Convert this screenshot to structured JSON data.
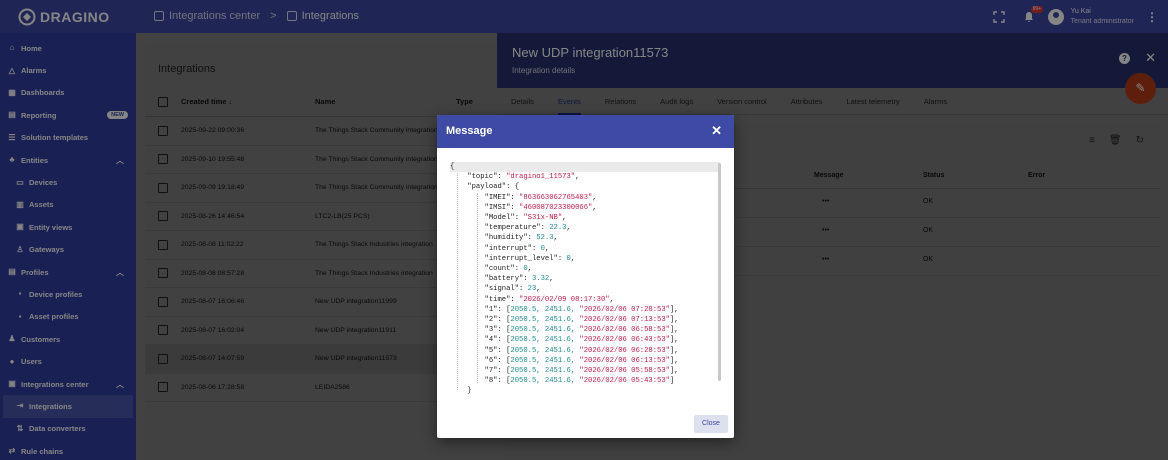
{
  "app": {
    "logo_text": "DRAGINO"
  },
  "breadcrumb": {
    "parent": "Integrations center",
    "current": "Integrations",
    "separator": ">"
  },
  "topbar": {
    "notification_count": "99+",
    "user_name": "Yu Kai",
    "user_role": "Tenant administrator"
  },
  "sidebar": {
    "items": [
      {
        "label": "Home",
        "icon": "home-icon"
      },
      {
        "label": "Alarms",
        "icon": "alarm-icon"
      },
      {
        "label": "Dashboards",
        "icon": "dashboard-icon"
      },
      {
        "label": "Reporting",
        "icon": "reporting-icon",
        "badge": "NEW"
      },
      {
        "label": "Solution templates",
        "icon": "template-icon"
      },
      {
        "label": "Entities",
        "icon": "entities-icon"
      },
      {
        "label": "Devices",
        "icon": "devices-icon"
      },
      {
        "label": "Assets",
        "icon": "assets-icon"
      },
      {
        "label": "Entity views",
        "icon": "entity-views-icon"
      },
      {
        "label": "Gateways",
        "icon": "gateways-icon"
      },
      {
        "label": "Profiles",
        "icon": "profiles-icon"
      },
      {
        "label": "Device profiles",
        "icon": "device-profiles-icon"
      },
      {
        "label": "Asset profiles",
        "icon": "asset-profiles-icon"
      },
      {
        "label": "Customers",
        "icon": "customers-icon"
      },
      {
        "label": "Users",
        "icon": "users-icon"
      },
      {
        "label": "Integrations center",
        "icon": "integrations-center-icon"
      },
      {
        "label": "Integrations",
        "icon": "integrations-icon"
      },
      {
        "label": "Data converters",
        "icon": "data-converters-icon"
      },
      {
        "label": "Rule chains",
        "icon": "rule-chains-icon"
      }
    ]
  },
  "integrations": {
    "title": "Integrations",
    "columns": {
      "created": "Created time",
      "name": "Name",
      "type": "Type"
    },
    "rows": [
      {
        "created": "2025-09-22 09:00:36",
        "name": "The Things Stack Community integration"
      },
      {
        "created": "2025-09-10 19:55:48",
        "name": "The Things Stack Community integration"
      },
      {
        "created": "2025-09-09 19:18:49",
        "name": "The Things Stack Community integration"
      },
      {
        "created": "2025-08-26 14:46:54",
        "name": "LTC2-LB(25 PCS)"
      },
      {
        "created": "2025-08-08 11:02:22",
        "name": "The Things Stack Industries integration"
      },
      {
        "created": "2025-08-08 08:57:28",
        "name": "The Things Stack Industries integration"
      },
      {
        "created": "2025-08-07 16:06:46",
        "name": "New UDP integration11999"
      },
      {
        "created": "2025-08-07 16:02:04",
        "name": "New UDP integration11911"
      },
      {
        "created": "2025-08-07 14:07:59",
        "name": "New UDP integration11573"
      },
      {
        "created": "2025-08-06 17:28:58",
        "name": "LEIDA2586"
      }
    ]
  },
  "details": {
    "title": "New UDP integration11573",
    "subtitle": "Integration details",
    "tabs": [
      "Details",
      "Events",
      "Relations",
      "Audit logs",
      "Version control",
      "Attributes",
      "Latest telemetry",
      "Alarms"
    ],
    "events": {
      "columns": {
        "message": "Message",
        "status": "Status",
        "error": "Error"
      },
      "rows": [
        {
          "message": "•••",
          "status": "OK"
        },
        {
          "message": "•••",
          "status": "OK"
        },
        {
          "message": "•••",
          "status": "OK"
        }
      ]
    }
  },
  "dialog": {
    "title": "Message",
    "close_label": "Close",
    "json_lines": [
      {
        "text": "{",
        "cls": "k"
      },
      {
        "text": "    \"topic\": ",
        "val": "\"dragino1_11573\"",
        "vcls": "s",
        "tail": ","
      },
      {
        "text": "    \"payload\": {",
        "cls": "k"
      },
      {
        "text": "        \"IMEI\": ",
        "val": "\"863663062765403\"",
        "vcls": "s",
        "tail": ","
      },
      {
        "text": "        \"IMSI\": ",
        "val": "\"460087023300066\"",
        "vcls": "s",
        "tail": ","
      },
      {
        "text": "        \"Model\": ",
        "val": "\"S31x-NB\"",
        "vcls": "s",
        "tail": ","
      },
      {
        "text": "        \"temperature\": ",
        "val": "22.3",
        "vcls": "n",
        "tail": ","
      },
      {
        "text": "        \"humidity\": ",
        "val": "52.3",
        "vcls": "n",
        "tail": ","
      },
      {
        "text": "        \"interrupt\": ",
        "val": "0",
        "vcls": "n",
        "tail": ","
      },
      {
        "text": "        \"interrupt_level\": ",
        "val": "0",
        "vcls": "n",
        "tail": ","
      },
      {
        "text": "        \"count\": ",
        "val": "0",
        "vcls": "n",
        "tail": ","
      },
      {
        "text": "        \"battery\": ",
        "val": "3.32",
        "vcls": "n",
        "tail": ","
      },
      {
        "text": "        \"signal\": ",
        "val": "23",
        "vcls": "n",
        "tail": ","
      },
      {
        "text": "        \"time\": ",
        "val": "\"2026/02/09 08:17:30\"",
        "vcls": "s",
        "tail": ","
      },
      {
        "text": "        \"1\": [",
        "val": "2050.5, 2451.6, ",
        "vcls": "n",
        "val2": "\"2026/02/06 07:28:53\"",
        "tail": "],"
      },
      {
        "text": "        \"2\": [",
        "val": "2050.5, 2451.6, ",
        "vcls": "n",
        "val2": "\"2026/02/06 07:13:53\"",
        "tail": "],"
      },
      {
        "text": "        \"3\": [",
        "val": "2050.5, 2451.6, ",
        "vcls": "n",
        "val2": "\"2026/02/06 06:58:53\"",
        "tail": "],"
      },
      {
        "text": "        \"4\": [",
        "val": "2050.5, 2451.6, ",
        "vcls": "n",
        "val2": "\"2026/02/06 06:43:53\"",
        "tail": "],"
      },
      {
        "text": "        \"5\": [",
        "val": "2050.5, 2451.6, ",
        "vcls": "n",
        "val2": "\"2026/02/06 06:28:53\"",
        "tail": "],"
      },
      {
        "text": "        \"6\": [",
        "val": "2050.5, 2451.6, ",
        "vcls": "n",
        "val2": "\"2026/02/06 06:13:53\"",
        "tail": "],"
      },
      {
        "text": "        \"7\": [",
        "val": "2050.5, 2451.6, ",
        "vcls": "n",
        "val2": "\"2026/02/06 05:58:53\"",
        "tail": "],"
      },
      {
        "text": "        \"8\": [",
        "val": "2050.5, 2451.6, ",
        "vcls": "n",
        "val2": "\"2026/02/06 05:43:53\"",
        "tail": "]"
      },
      {
        "text": "    }",
        "cls": "k"
      }
    ]
  }
}
